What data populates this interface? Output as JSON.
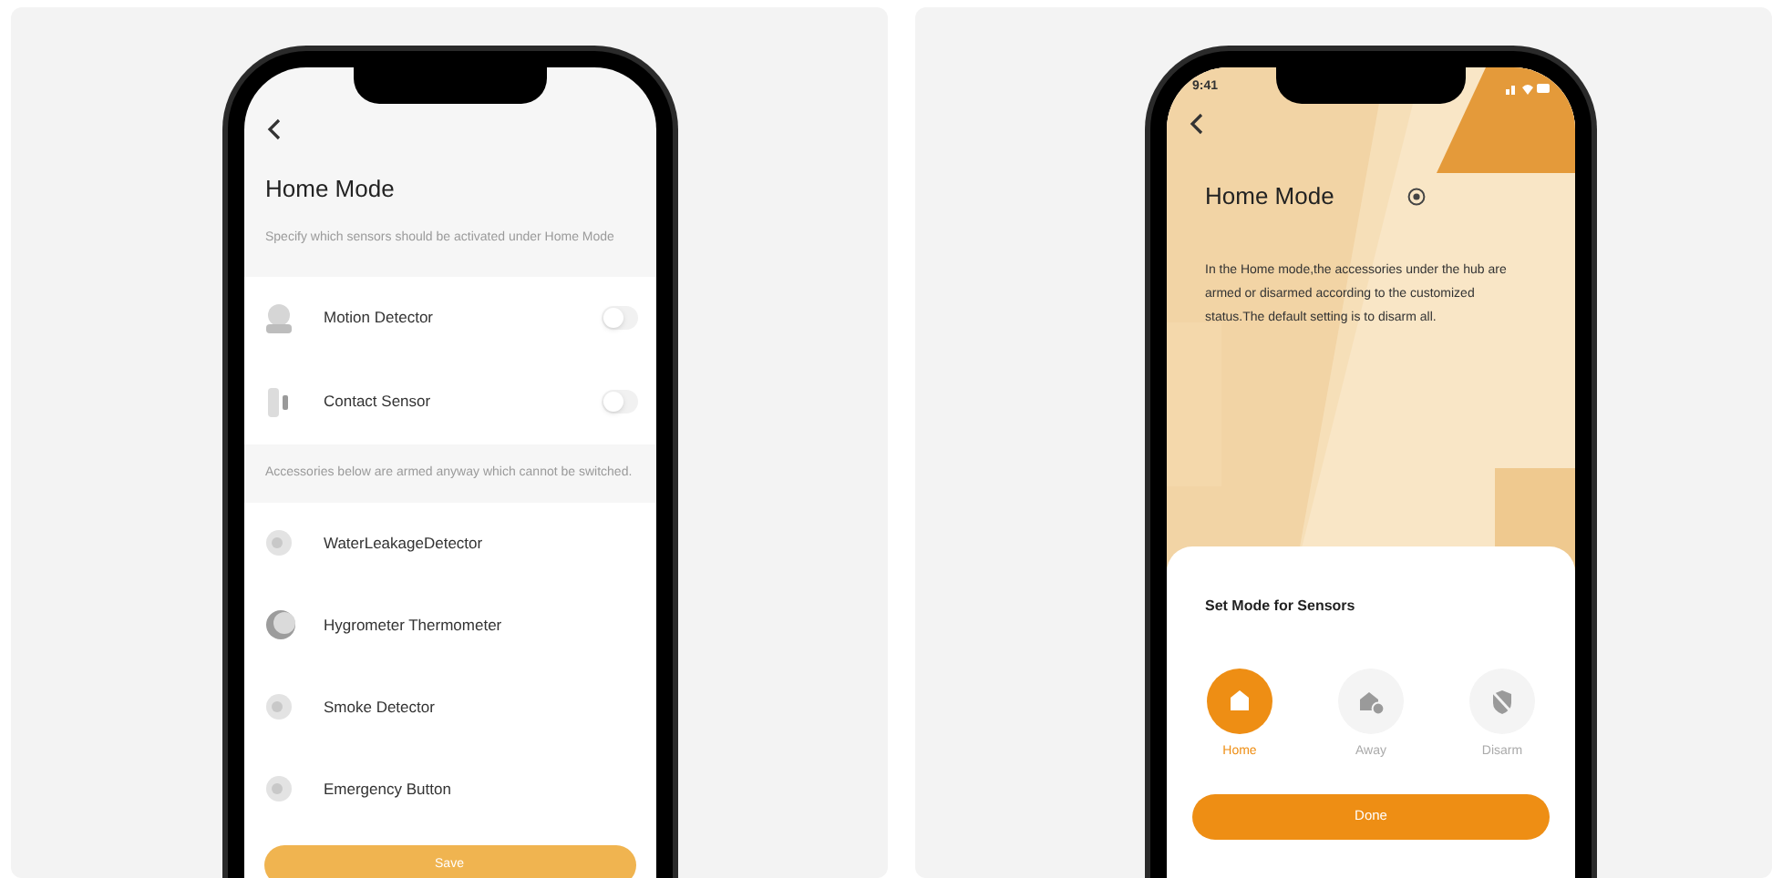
{
  "left_screen": {
    "title": "Home Mode",
    "description": "Specify which sensors should be activated under Home Mode",
    "sensors": [
      {
        "name": "Motion Detector",
        "kind": "motion",
        "on": false
      },
      {
        "name": "Contact Sensor",
        "kind": "contact",
        "on": false
      }
    ],
    "armed_note": "Accessories below are armed anyway which cannot be switched.",
    "armed_accessories": [
      {
        "name": "WaterLeakageDetector",
        "kind": "disc"
      },
      {
        "name": "Hygrometer Thermometer",
        "kind": "dome"
      },
      {
        "name": "Smoke Detector",
        "kind": "disc"
      },
      {
        "name": "Emergency Button",
        "kind": "disc"
      }
    ],
    "save_button": "Save"
  },
  "right_screen": {
    "status_time": "9:41",
    "title": "Home Mode",
    "description": "In the Home mode,the accessories under the hub are armed or disarmed according to the customized status.The default setting is to disarm all.",
    "sheet_title": "Set Mode for Sensors",
    "modes": [
      {
        "label": "Home",
        "kind": "home",
        "selected": true
      },
      {
        "label": "Away",
        "kind": "away",
        "selected": false
      },
      {
        "label": "Disarm",
        "kind": "disarm",
        "selected": false
      }
    ],
    "done_button": "Done"
  }
}
